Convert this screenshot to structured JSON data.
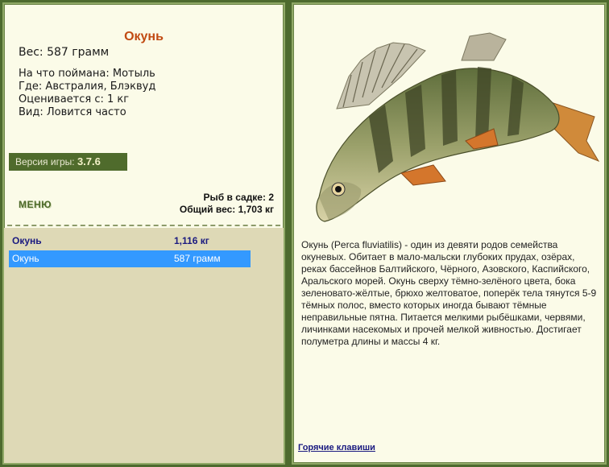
{
  "fish": {
    "name": "Окунь",
    "weight": "Вес: 587 грамм",
    "bait": "На что поймана: Мотыль",
    "location": "Где: Австралия, Блэквуд",
    "value": "Оценивается с: 1 кг",
    "frequency": "Вид: Ловится часто"
  },
  "version": {
    "label": "Версия игры: ",
    "number": "3.7.6"
  },
  "menu": {
    "label": "МЕНЮ"
  },
  "keepnet": {
    "count": "Рыб в садке: 2",
    "total": "Общий вес: 1,703 кг"
  },
  "catch_list": [
    {
      "name": "Окунь",
      "weight": "1,116 кг"
    },
    {
      "name": "Окунь",
      "weight": "587 грамм"
    }
  ],
  "description": "Окунь (Perca fluviatilis) - один из девяти родов семейства окуневых. Обитает в мало-мальски глубоких прудах, озёрах, реках бассейнов Балтийского, Чёрного, Азовского, Каспийского, Аральского морей. Окунь сверху тёмно-зелёного цвета, бока зеленовато-жёлтые, брюхо желтоватое, поперёк тела тянутся 5-9 тёмных полос, вместо которых иногда бывают тёмные неправильные пятна. Питается мелкими рыбёшками, червями, личинками насекомых и прочей мелкой живностью. Достигает полуметра длины и массы 4 кг.",
  "hotkeys": "Горячие клавиши",
  "colors": {
    "frame": "#4d6a2e",
    "panel": "#fbfbe8",
    "list_bg": "#ded9b6",
    "title": "#c14a12",
    "selection": "#3399ff",
    "link": "#1a1a80"
  }
}
